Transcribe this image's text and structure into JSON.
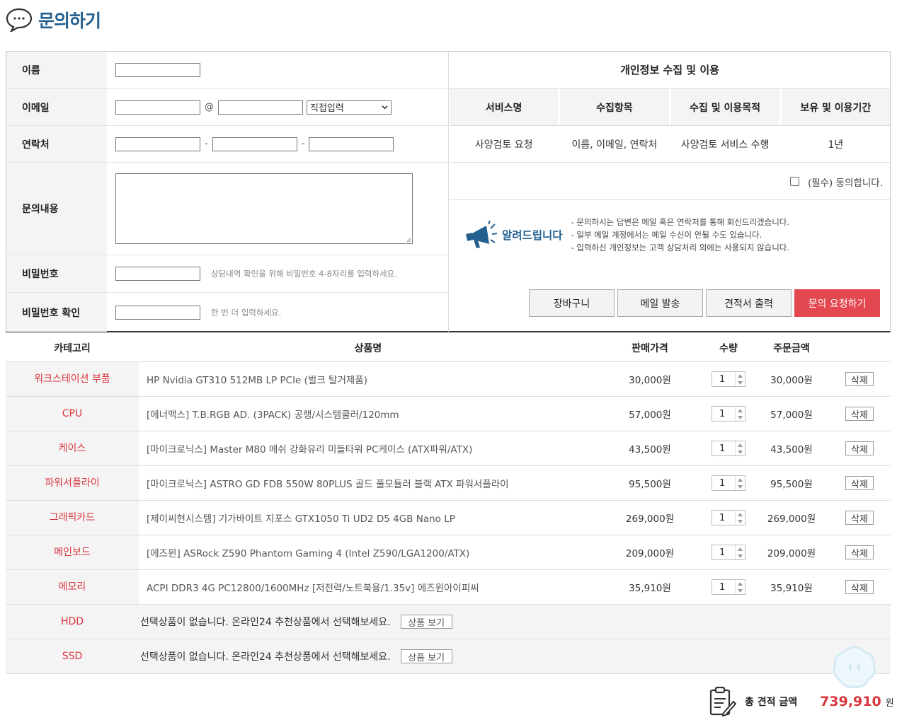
{
  "page_title": "문의하기",
  "form": {
    "name_label": "이름",
    "email_label": "이메일",
    "email_at": "@",
    "email_domain_select": "직접입력",
    "phone_label": "연락처",
    "phone_sep": "-",
    "content_label": "문의내용",
    "password_label": "비밀번호",
    "password_hint": "상담내역 확인을 위해 비밀번호 4-8자리를 입력하세요.",
    "password_confirm_label": "비밀번호 확인",
    "password_confirm_hint": "한 번 더 입력하세요."
  },
  "privacy": {
    "title": "개인정보 수집 및 이용",
    "headers": [
      "서비스명",
      "수집항목",
      "수집 및 이용목적",
      "보유 및 이용기간"
    ],
    "row": [
      "사양검토 요청",
      "이름, 이메일, 연락처",
      "사양검토 서비스 수행",
      "1년"
    ],
    "agree_label": "(필수) 동의합니다."
  },
  "notice": {
    "title": "알려드립니다",
    "lines": [
      "- 문의하시는 답변은 메일 혹은 연락처를 통해 회신드리겠습니다.",
      "- 일부 메일 계정에서는 메일 수신이 안될 수도 있습니다.",
      "- 입력하신 개인정보는 고객 상담처리 외에는 사용되지 않습니다."
    ]
  },
  "buttons": {
    "cart": "장바구니",
    "send_mail": "메일 발송",
    "print_quote": "견적서 출력",
    "submit": "문의 요청하기"
  },
  "list": {
    "headers": {
      "category": "카테고리",
      "name": "상품명",
      "price": "판매가격",
      "qty": "수량",
      "amount": "주문금액"
    },
    "delete_label": "삭제",
    "items": [
      {
        "category": "워크스테이션 부품",
        "name": "HP Nvidia GT310 512MB LP PCIe (벌크 탈거제품)",
        "price": "30,000원",
        "qty": "1",
        "amount": "30,000원"
      },
      {
        "category": "CPU",
        "name": "[에너맥스] T.B.RGB AD. (3PACK) 공랭/시스템쿨러/120mm",
        "price": "57,000원",
        "qty": "1",
        "amount": "57,000원"
      },
      {
        "category": "케이스",
        "name": "[마이크로닉스] Master M80 메쉬 강화유리 미들타워 PC케이스 (ATX파워/ATX)",
        "price": "43,500원",
        "qty": "1",
        "amount": "43,500원"
      },
      {
        "category": "파워서플라이",
        "name": "[마이크로닉스] ASTRO GD FDB 550W 80PLUS 골드 풀모듈러 블랙 ATX 파워서플라이",
        "price": "95,500원",
        "qty": "1",
        "amount": "95,500원"
      },
      {
        "category": "그래픽카드",
        "name": "[제이씨현시스템] 기가바이트 지포스 GTX1050 Ti UD2 D5 4GB Nano LP",
        "price": "269,000원",
        "qty": "1",
        "amount": "269,000원"
      },
      {
        "category": "메인보드",
        "name": "[에즈윈] ASRock Z590 Phantom Gaming 4 (Intel Z590/LGA1200/ATX)",
        "price": "209,000원",
        "qty": "1",
        "amount": "209,000원"
      },
      {
        "category": "메모리",
        "name": "ACPI DDR3 4G PC12800/1600MHz [저전력/노트북용/1.35v] 에즈윈아이피씨",
        "price": "35,910원",
        "qty": "1",
        "amount": "35,910원"
      }
    ],
    "empty_message": "선택상품이 없습니다. 온라인24 추천상품에서 선택해보세요.",
    "view_button": "상품 보기",
    "empty_items": [
      {
        "category": "HDD"
      },
      {
        "category": "SSD"
      }
    ]
  },
  "total": {
    "label": "총 견적 금액",
    "value": "739,910",
    "unit": "원"
  },
  "colors": {
    "brand_blue": "#24608f",
    "accent_red": "#e3474f",
    "category_red": "#d9353d"
  },
  "icons": {
    "title": "speech-bubble-icon",
    "notice": "megaphone-icon",
    "total": "clipboard-icon"
  }
}
